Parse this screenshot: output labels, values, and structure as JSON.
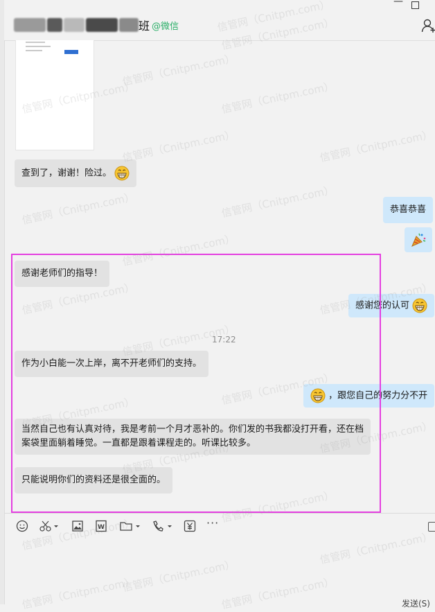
{
  "header": {
    "title_tail": "班",
    "wechat_tag": "@微信",
    "minimize_glyph": "—"
  },
  "messages": {
    "m1": {
      "text": "查到了，谢谢！险过。",
      "emoji": "grin-emoji"
    },
    "m2": {
      "text": "恭喜恭喜"
    },
    "m3": {
      "emoji": "party-popper-icon"
    },
    "m4": {
      "text": "感谢老师们的指导！"
    },
    "m5": {
      "text": "感谢您的认可",
      "emoji": "grin-emoji"
    },
    "time": "17:22",
    "m6": {
      "text": "作为小白能一次上岸，离不开老师们的支持。"
    },
    "m7": {
      "text": "，跟您自己的努力分不开",
      "emoji": "grin-emoji"
    },
    "m8": {
      "line1": "当然自己也有认真对待，我是考前一个月才恶补的。你们发的书我都没打开看，还在档",
      "line2": "案袋里面躺着睡觉。一直都是跟着课程走的。听课比较多。"
    },
    "m9": {
      "text": "只能说明你们的资料还是很全面的。"
    }
  },
  "toolbar": {
    "icons": [
      "emoji-icon",
      "scissors-icon",
      "image-icon",
      "word-doc-icon",
      "folder-icon",
      "phone-icon",
      "yen-transfer-icon",
      "more-icon"
    ],
    "more_label": "···",
    "send_label": "发送(S)"
  },
  "watermark": "信管网（Cnitpm.com）",
  "colors": {
    "incoming": "#e2e2e2",
    "outgoing": "#cfe8fb",
    "highlight": "#e43ee0",
    "wechat_green": "#2aae67"
  }
}
